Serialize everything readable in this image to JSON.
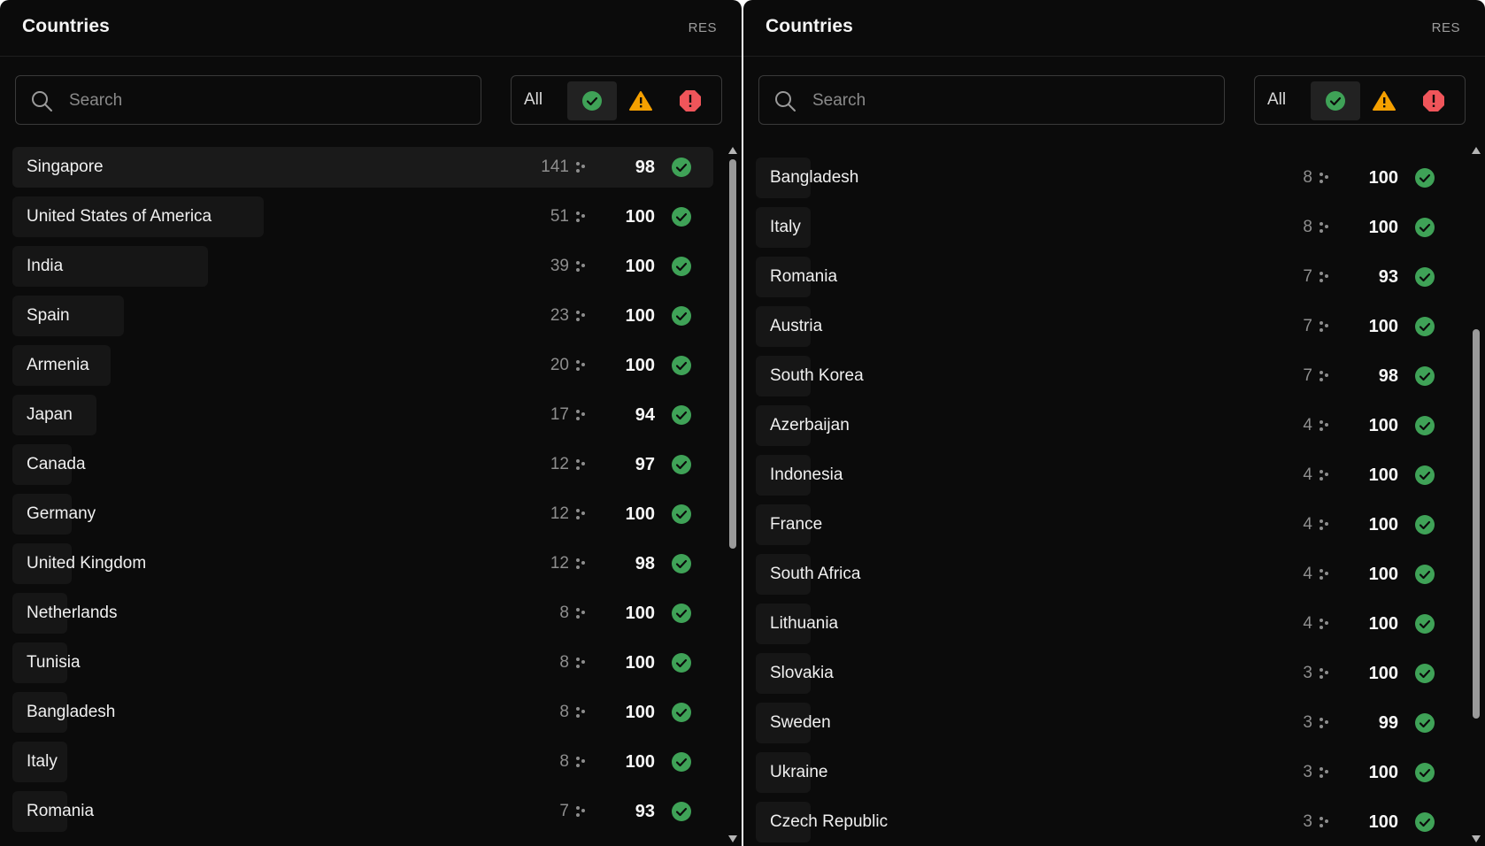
{
  "colors": {
    "background": "#0b0b0b",
    "ok": "#3fa257",
    "warning": "#f5a000",
    "error": "#f0555a"
  },
  "panels": [
    {
      "title": "Countries",
      "res_label": "RES",
      "search_placeholder": "Search",
      "filter_all_label": "All",
      "active_filter": "ok",
      "scroll_position": 0.0,
      "rows": [
        {
          "name": "Singapore",
          "count": "141",
          "score": "98",
          "status": "ok-icon",
          "selected": true,
          "share": 1.0
        },
        {
          "name": "United States of America",
          "count": "51",
          "score": "100",
          "status": "ok-icon",
          "share": 0.36
        },
        {
          "name": "India",
          "count": "39",
          "score": "100",
          "status": "ok-icon",
          "share": 0.28
        },
        {
          "name": "Spain",
          "count": "23",
          "score": "100",
          "status": "ok-icon",
          "share": 0.16
        },
        {
          "name": "Armenia",
          "count": "20",
          "score": "100",
          "status": "ok-icon",
          "share": 0.14
        },
        {
          "name": "Japan",
          "count": "17",
          "score": "94",
          "status": "ok-icon",
          "share": 0.12
        },
        {
          "name": "Canada",
          "count": "12",
          "score": "97",
          "status": "ok-icon",
          "share": 0.085
        },
        {
          "name": "Germany",
          "count": "12",
          "score": "100",
          "status": "ok-icon",
          "share": 0.085
        },
        {
          "name": "United Kingdom",
          "count": "12",
          "score": "98",
          "status": "ok-icon",
          "share": 0.085
        },
        {
          "name": "Netherlands",
          "count": "8",
          "score": "100",
          "status": "ok-icon",
          "share": 0.057
        },
        {
          "name": "Tunisia",
          "count": "8",
          "score": "100",
          "status": "ok-icon",
          "share": 0.057
        },
        {
          "name": "Bangladesh",
          "count": "8",
          "score": "100",
          "status": "ok-icon",
          "share": 0.057
        },
        {
          "name": "Italy",
          "count": "8",
          "score": "100",
          "status": "ok-icon",
          "share": 0.057
        },
        {
          "name": "Romania",
          "count": "7",
          "score": "93",
          "status": "ok-icon",
          "share": 0.05
        }
      ]
    },
    {
      "title": "Countries",
      "res_label": "RES",
      "search_placeholder": "Search",
      "filter_all_label": "All",
      "active_filter": "ok",
      "scroll_position": 0.6,
      "rows": [
        {
          "name": "Bangladesh",
          "count": "8",
          "score": "100",
          "status": "ok-icon",
          "share": 0.057
        },
        {
          "name": "Italy",
          "count": "8",
          "score": "100",
          "status": "ok-icon",
          "share": 0.057
        },
        {
          "name": "Romania",
          "count": "7",
          "score": "93",
          "status": "ok-icon",
          "share": 0.05
        },
        {
          "name": "Austria",
          "count": "7",
          "score": "100",
          "status": "ok-icon",
          "share": 0.05
        },
        {
          "name": "South Korea",
          "count": "7",
          "score": "98",
          "status": "ok-icon",
          "share": 0.05
        },
        {
          "name": "Azerbaijan",
          "count": "4",
          "score": "100",
          "status": "ok-icon",
          "share": 0.028
        },
        {
          "name": "Indonesia",
          "count": "4",
          "score": "100",
          "status": "ok-icon",
          "share": 0.028
        },
        {
          "name": "France",
          "count": "4",
          "score": "100",
          "status": "ok-icon",
          "share": 0.028
        },
        {
          "name": "South Africa",
          "count": "4",
          "score": "100",
          "status": "ok-icon",
          "share": 0.028
        },
        {
          "name": "Lithuania",
          "count": "4",
          "score": "100",
          "status": "ok-icon",
          "share": 0.028
        },
        {
          "name": "Slovakia",
          "count": "3",
          "score": "100",
          "status": "ok-icon",
          "share": 0.021
        },
        {
          "name": "Sweden",
          "count": "3",
          "score": "99",
          "status": "ok-icon",
          "share": 0.021
        },
        {
          "name": "Ukraine",
          "count": "3",
          "score": "100",
          "status": "ok-icon",
          "share": 0.021
        },
        {
          "name": "Czech Republic",
          "count": "3",
          "score": "100",
          "status": "ok-icon",
          "share": 0.021
        }
      ]
    }
  ]
}
